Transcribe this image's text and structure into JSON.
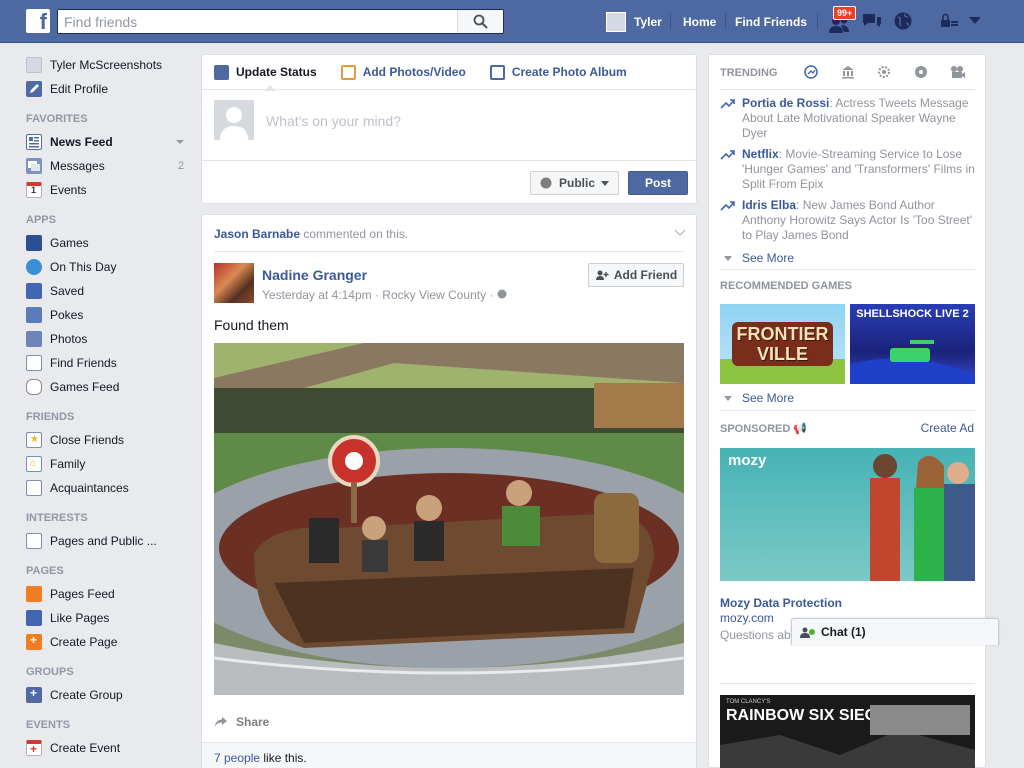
{
  "topbar": {
    "logo": "f",
    "search_placeholder": "Find friends",
    "profile_name": "Tyler",
    "home": "Home",
    "find_friends": "Find Friends",
    "friend_requests_badge": "99+"
  },
  "left_nav": {
    "profile_name": "Tyler McScreenshots",
    "edit_profile": "Edit Profile",
    "favorites_header": "FAVORITES",
    "news_feed": "News Feed",
    "messages": "Messages",
    "messages_count": "2",
    "events": "Events",
    "apps_header": "APPS",
    "apps": [
      "Games",
      "On This Day",
      "Saved",
      "Pokes",
      "Photos",
      "Find Friends",
      "Games Feed"
    ],
    "friends_header": "FRIENDS",
    "friends": [
      "Close Friends",
      "Family",
      "Acquaintances"
    ],
    "interests_header": "INTERESTS",
    "interests": [
      "Pages and Public ..."
    ],
    "pages_header": "PAGES",
    "pages": [
      "Pages Feed",
      "Like Pages",
      "Create Page"
    ],
    "groups_header": "GROUPS",
    "groups": [
      "Create Group"
    ],
    "events_header": "EVENTS",
    "events_items": [
      "Create Event"
    ]
  },
  "composer": {
    "tab_status": "Update Status",
    "tab_photos": "Add Photos/Video",
    "tab_album": "Create Photo Album",
    "placeholder": "What's on your mind?",
    "privacy": "Public",
    "post": "Post"
  },
  "story": {
    "context_actor": "Jason Barnabe",
    "context_action": " commented on this.",
    "author": "Nadine Granger",
    "meta": "Yesterday at 4:14pm · Rocky View County ·",
    "add_friend": "Add Friend",
    "text": "Found them",
    "share": "Share",
    "likes_link": "7 people",
    "likes_suffix": " like this."
  },
  "right_col": {
    "trending_header": "TRENDING",
    "trending": [
      {
        "topic": "Portia de Rossi",
        "desc": ": Actress Tweets Message About Late Motivational Speaker Wayne Dyer"
      },
      {
        "topic": "Netflix",
        "desc": ": Movie-Streaming Service to Lose 'Hunger Games' and 'Transformers' Films in Split From Epix"
      },
      {
        "topic": "Idris Elba",
        "desc": ": New James Bond Author Anthony Horowitz Says Actor Is 'Too Street' to Play James Bond"
      }
    ],
    "see_more": "See More",
    "games_header": "RECOMMENDED GAMES",
    "game1_title": "FRONTIER VILLE",
    "game2_title": "SHELLSHOCK LIVE 2",
    "see_more_games": "See More",
    "sponsored_header": "SPONSORED",
    "create_ad": "Create Ad",
    "ad_brand": "mozy",
    "ad_title": "Mozy Data Protection",
    "ad_url": "mozy.com",
    "ad_body": "Questions ab... Account Executive.",
    "ad2_title": "RAINBOW SIX SIEGE",
    "ad2_tag": "TOM CLANCY'S"
  },
  "chat": {
    "label": "Chat (1)"
  }
}
